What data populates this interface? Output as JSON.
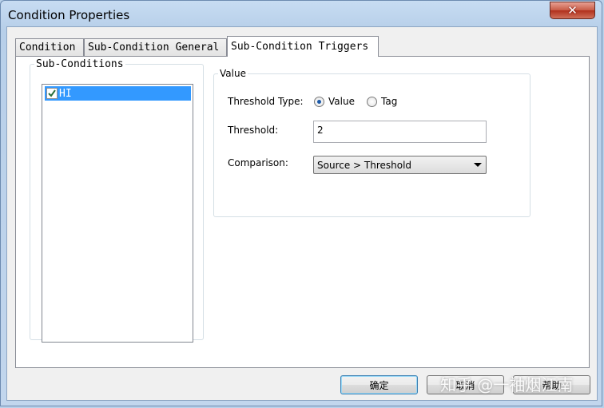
{
  "window": {
    "title": "Condition Properties",
    "close_label": "✕"
  },
  "tabs": [
    {
      "label": "Condition"
    },
    {
      "label": "Sub-Condition General"
    },
    {
      "label": "Sub-Condition Triggers"
    }
  ],
  "active_tab": "Sub-Condition Triggers",
  "sub_conditions": {
    "legend": "Sub-Conditions",
    "items": [
      {
        "label": "HI",
        "checked": true,
        "selected": true
      }
    ]
  },
  "value_group": {
    "legend": "Value",
    "threshold_type_label": "Threshold Type:",
    "radio_value_label": "Value",
    "radio_tag_label": "Tag",
    "selected_radio": "Value",
    "threshold_label": "Threshold:",
    "threshold_value": "2",
    "comparison_label": "Comparison:",
    "comparison_selected": "Source > Threshold"
  },
  "buttons": {
    "ok": "确定",
    "cancel": "取消",
    "help": "帮助"
  },
  "watermark": "知乎 @一袖烟江南",
  "colors": {
    "selection": "#3399ff",
    "titlebar": "#b9d1ea",
    "close": "#c75a45"
  },
  "icons": [
    "close-icon",
    "checkbox-checked-icon",
    "dropdown-arrow-icon"
  ]
}
